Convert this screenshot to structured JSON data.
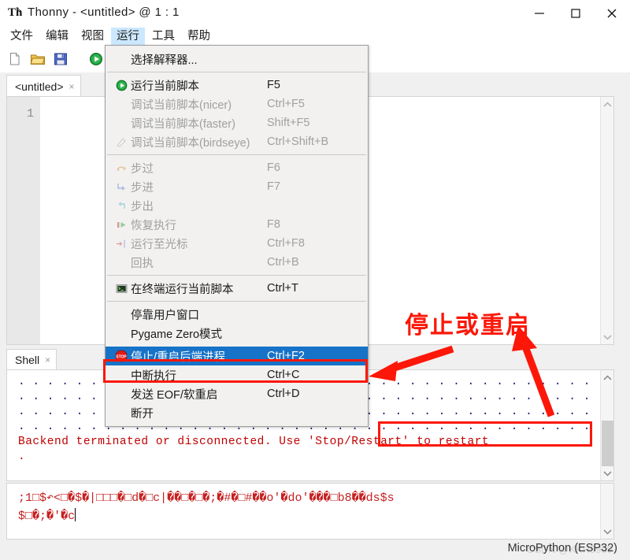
{
  "window": {
    "title": "Thonny - <untitled> @ 1 : 1",
    "app_icon": "thonny-icon",
    "minimize_label": "—",
    "maximize_label": "□",
    "close_label": "✕"
  },
  "menubar": {
    "items": [
      {
        "label": "文件",
        "name": "menu-file",
        "active": false
      },
      {
        "label": "编辑",
        "name": "menu-edit",
        "active": false
      },
      {
        "label": "视图",
        "name": "menu-view",
        "active": false
      },
      {
        "label": "运行",
        "name": "menu-run",
        "active": true
      },
      {
        "label": "工具",
        "name": "menu-tools",
        "active": false
      },
      {
        "label": "帮助",
        "name": "menu-help",
        "active": false
      }
    ]
  },
  "toolbar": {
    "buttons": [
      {
        "name": "new-file-icon",
        "title": "New"
      },
      {
        "name": "open-file-icon",
        "title": "Open"
      },
      {
        "name": "save-file-icon",
        "title": "Save"
      },
      {
        "name": "run-script-icon",
        "title": "Run"
      },
      {
        "name": "debug-script-icon",
        "title": "Debug"
      }
    ]
  },
  "editor": {
    "tab_label": "<untitled>",
    "tab_close": "×",
    "line_number": "1",
    "content": ""
  },
  "run_menu": {
    "groups": [
      {
        "items": [
          {
            "label": "选择解释器...",
            "accel": "",
            "icon": "",
            "state": "normal",
            "name": "menuitem-select-interpreter"
          }
        ]
      },
      {
        "items": [
          {
            "label": "运行当前脚本",
            "accel": "F5",
            "icon": "play-icon",
            "state": "normal",
            "name": "menuitem-run-current-script"
          },
          {
            "label": "调试当前脚本(nicer)",
            "accel": "Ctrl+F5",
            "icon": "",
            "state": "disabled",
            "name": "menuitem-debug-nicer"
          },
          {
            "label": "调试当前脚本(faster)",
            "accel": "Shift+F5",
            "icon": "",
            "state": "disabled",
            "name": "menuitem-debug-faster"
          },
          {
            "label": "调试当前脚本(birdseye)",
            "accel": "Ctrl+Shift+B",
            "icon": "birdseye-icon",
            "state": "disabled",
            "name": "menuitem-debug-birdseye"
          }
        ]
      },
      {
        "items": [
          {
            "label": "步过",
            "accel": "F6",
            "icon": "step-over-icon",
            "state": "disabled",
            "name": "menuitem-step-over"
          },
          {
            "label": "步进",
            "accel": "F7",
            "icon": "step-into-icon",
            "state": "disabled",
            "name": "menuitem-step-into"
          },
          {
            "label": "步出",
            "accel": "",
            "icon": "step-out-icon",
            "state": "disabled",
            "name": "menuitem-step-out"
          },
          {
            "label": "恢复执行",
            "accel": "F8",
            "icon": "resume-icon",
            "state": "disabled",
            "name": "menuitem-resume"
          },
          {
            "label": "运行至光标",
            "accel": "Ctrl+F8",
            "icon": "run-to-cursor-icon",
            "state": "disabled",
            "name": "menuitem-run-to-cursor"
          },
          {
            "label": "回执",
            "accel": "Ctrl+B",
            "icon": "",
            "state": "disabled",
            "name": "menuitem-step-back"
          }
        ]
      },
      {
        "items": [
          {
            "label": "在终端运行当前脚本",
            "accel": "Ctrl+T",
            "icon": "terminal-icon",
            "state": "normal",
            "name": "menuitem-run-in-terminal"
          }
        ]
      },
      {
        "items": [
          {
            "label": "停靠用户窗口",
            "accel": "",
            "icon": "",
            "state": "normal",
            "name": "menuitem-dock-user-windows"
          },
          {
            "label": "Pygame Zero模式",
            "accel": "",
            "icon": "",
            "state": "normal",
            "name": "menuitem-pygame-zero-mode"
          }
        ]
      },
      {
        "items": [
          {
            "label": "停止/重启后端进程",
            "accel": "Ctrl+F2",
            "icon": "stop-icon",
            "state": "selected",
            "name": "menuitem-stop-restart-backend"
          },
          {
            "label": "中断执行",
            "accel": "Ctrl+C",
            "icon": "",
            "state": "normal",
            "name": "menuitem-interrupt-execution"
          },
          {
            "label": "发送 EOF/软重启",
            "accel": "Ctrl+D",
            "icon": "",
            "state": "normal",
            "name": "menuitem-send-eof-soft-reboot"
          },
          {
            "label": "断开",
            "accel": "",
            "icon": "",
            "state": "normal",
            "name": "menuitem-disconnect"
          }
        ]
      }
    ]
  },
  "shell": {
    "tab_label": "Shell",
    "tab_close": "×",
    "lines": [
      {
        "kind": "dots",
        "text": ". . . . . . . . . . . . . . . . . . . . . . . . . . . . . . . . . . . . . . . . . ."
      },
      {
        "kind": "dots",
        "text": ". . . . . . . . . . . . . . . . . . . . . . . . . . . . . . . . . . . . . . . . . ."
      },
      {
        "kind": "dots",
        "text": ". . . . . . . . . . . . . . . . . . . . . . . . . . . . . . . . . . . . . . . . . ."
      },
      {
        "kind": "dots",
        "text": ". . . . . . . . . . . . . . . . . . . . . . . . . . . . . . . . . . . . . . . . . ."
      },
      {
        "kind": "error",
        "text": "Backend terminated or disconnected. Use 'Stop/Restart' to restart"
      },
      {
        "kind": "error",
        "text": "."
      }
    ]
  },
  "shell_output": {
    "lines": [
      ";1□$↶<□�$�|□□□�□d�□c|��□�□�;�#�□#��o'�do'���□b8��ds$s",
      "$□�;�'�c"
    ]
  },
  "statusbar": {
    "interpreter": "MicroPython (ESP32)",
    "watermark": "CSDN @KKH9999"
  },
  "annotations": {
    "heading": "停止或重启",
    "color": "#fc1708",
    "boxes": [
      {
        "name": "annotation-box-menuitem"
      },
      {
        "name": "annotation-box-shell-text"
      }
    ],
    "arrows": [
      {
        "name": "annotation-arrow-to-menuitem"
      },
      {
        "name": "annotation-arrow-to-shell-text"
      }
    ]
  }
}
